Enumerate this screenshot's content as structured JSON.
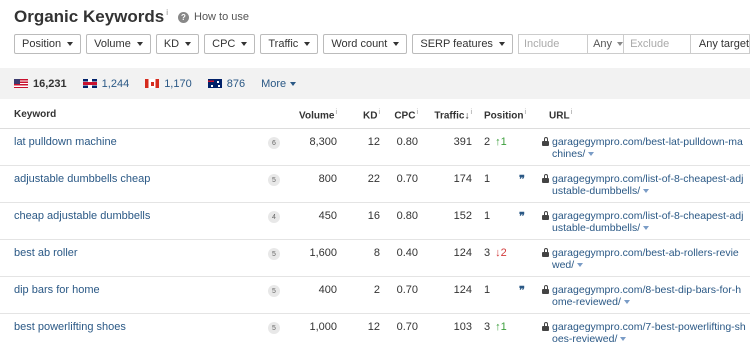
{
  "header": {
    "title": "Organic Keywords",
    "title_info": "i",
    "how_to_use": "How to use"
  },
  "filters": {
    "buttons": [
      "Position",
      "Volume",
      "KD",
      "CPC",
      "Traffic",
      "Word count",
      "SERP features"
    ],
    "include_placeholder": "Include",
    "any_label": "Any",
    "exclude_placeholder": "Exclude",
    "any_target_label": "Any target"
  },
  "countries": [
    {
      "flag": "flag-us",
      "count": "16,231",
      "active": true
    },
    {
      "flag": "flag-uk",
      "count": "1,244",
      "active": false
    },
    {
      "flag": "flag-ca",
      "count": "1,170",
      "active": false
    },
    {
      "flag": "flag-au",
      "count": "876",
      "active": false
    }
  ],
  "more_label": "More",
  "table": {
    "headers": {
      "keyword": "Keyword",
      "volume": "Volume",
      "kd": "KD",
      "cpc": "CPC",
      "traffic": "Traffic",
      "traffic_sort": "↓",
      "position": "Position",
      "url": "URL",
      "info": "i"
    },
    "rows": [
      {
        "keyword": "lat pulldown machine",
        "serp": "6",
        "volume": "8,300",
        "kd": "12",
        "cpc": "0.80",
        "traffic": "391",
        "position": "2",
        "change": "↑1",
        "change_dir": "up",
        "feature": "",
        "url": "garagegympro.com/best-lat-pulldown-machines/"
      },
      {
        "keyword": "adjustable dumbbells cheap",
        "serp": "5",
        "volume": "800",
        "kd": "22",
        "cpc": "0.70",
        "traffic": "174",
        "position": "1",
        "change": "",
        "change_dir": "",
        "feature": "❞",
        "url": "garagegympro.com/list-of-8-cheapest-adjustable-dumbbells/"
      },
      {
        "keyword": "cheap adjustable dumbbells",
        "serp": "4",
        "volume": "450",
        "kd": "16",
        "cpc": "0.80",
        "traffic": "152",
        "position": "1",
        "change": "",
        "change_dir": "",
        "feature": "❞",
        "url": "garagegympro.com/list-of-8-cheapest-adjustable-dumbbells/"
      },
      {
        "keyword": "best ab roller",
        "serp": "5",
        "volume": "1,600",
        "kd": "8",
        "cpc": "0.40",
        "traffic": "124",
        "position": "3",
        "change": "↓2",
        "change_dir": "down",
        "feature": "",
        "url": "garagegympro.com/best-ab-rollers-reviewed/"
      },
      {
        "keyword": "dip bars for home",
        "serp": "5",
        "volume": "400",
        "kd": "2",
        "cpc": "0.70",
        "traffic": "124",
        "position": "1",
        "change": "",
        "change_dir": "",
        "feature": "❞",
        "url": "garagegympro.com/8-best-dip-bars-for-home-reviewed/"
      },
      {
        "keyword": "best powerlifting shoes",
        "serp": "5",
        "volume": "1,000",
        "kd": "12",
        "cpc": "0.70",
        "traffic": "103",
        "position": "3",
        "change": "↑1",
        "change_dir": "up",
        "feature": "",
        "url": "garagegympro.com/7-best-powerlifting-shoes-reviewed/"
      }
    ]
  },
  "colors": {
    "link": "#2a5885",
    "up": "#3c9e3c",
    "down": "#d23c3c",
    "country_bar": "#f2f2f2"
  }
}
